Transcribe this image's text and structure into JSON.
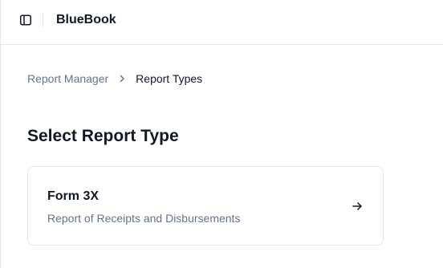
{
  "header": {
    "app_title": "BlueBook",
    "sidebar_toggle_icon": "sidebar-panel-icon"
  },
  "breadcrumb": {
    "items": [
      {
        "label": "Report Manager"
      },
      {
        "label": "Report Types"
      }
    ],
    "separator_icon": "chevron-right-icon"
  },
  "main": {
    "title": "Select Report Type",
    "report_types": [
      {
        "title": "Form 3X",
        "description": "Report of Receipts and Disbursements",
        "icon": "arrow-right-icon"
      }
    ]
  },
  "colors": {
    "text_primary": "#111827",
    "text_muted": "#64748b",
    "border": "#e5e7eb"
  }
}
